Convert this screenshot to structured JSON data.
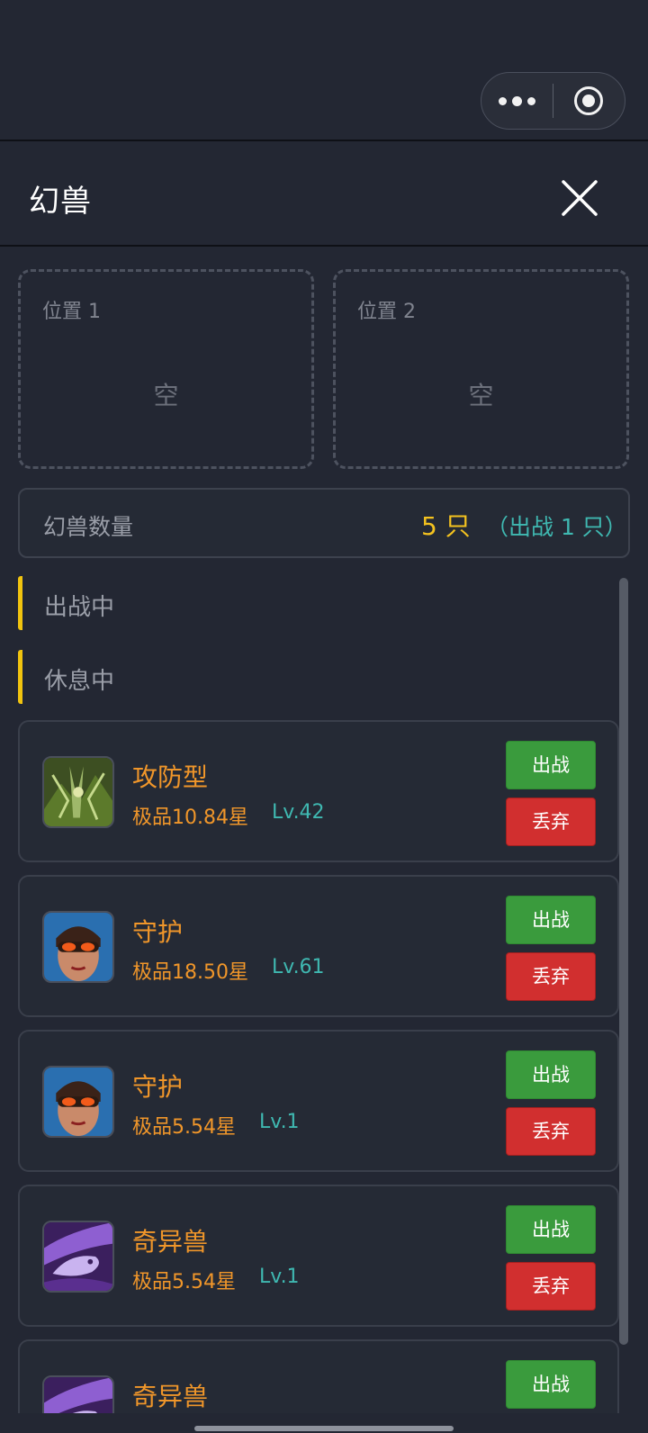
{
  "header": {
    "title": "幻兽"
  },
  "slots": [
    {
      "label": "位置 1",
      "content": "空"
    },
    {
      "label": "位置 2",
      "content": "空"
    }
  ],
  "summary": {
    "label": "幻兽数量",
    "count": "5 只",
    "active": "（出战 1 只）"
  },
  "sections": {
    "fighting": "出战中",
    "resting": "休息中"
  },
  "pets": [
    {
      "name": "攻防型",
      "star": "极品10.84星",
      "level": "Lv.42",
      "fight": "出战",
      "drop": "丢弃",
      "icon": "forest-beast-icon"
    },
    {
      "name": "守护",
      "star": "极品18.50星",
      "level": "Lv.61",
      "fight": "出战",
      "drop": "丢弃",
      "icon": "masked-warrior-icon"
    },
    {
      "name": "守护",
      "star": "极品5.54星",
      "level": "Lv.1",
      "fight": "出战",
      "drop": "丢弃",
      "icon": "masked-warrior-icon"
    },
    {
      "name": "奇异兽",
      "star": "极品5.54星",
      "level": "Lv.1",
      "fight": "出战",
      "drop": "丢弃",
      "icon": "purple-dragon-icon"
    },
    {
      "name": "奇异兽",
      "fight": "出战",
      "icon": "purple-dragon-icon"
    }
  ],
  "colors": {
    "accent": "#f1c40f",
    "name": "#f0962a",
    "level": "#3fb8b1",
    "fight": "#3a9b3d",
    "drop": "#d12f2f"
  }
}
